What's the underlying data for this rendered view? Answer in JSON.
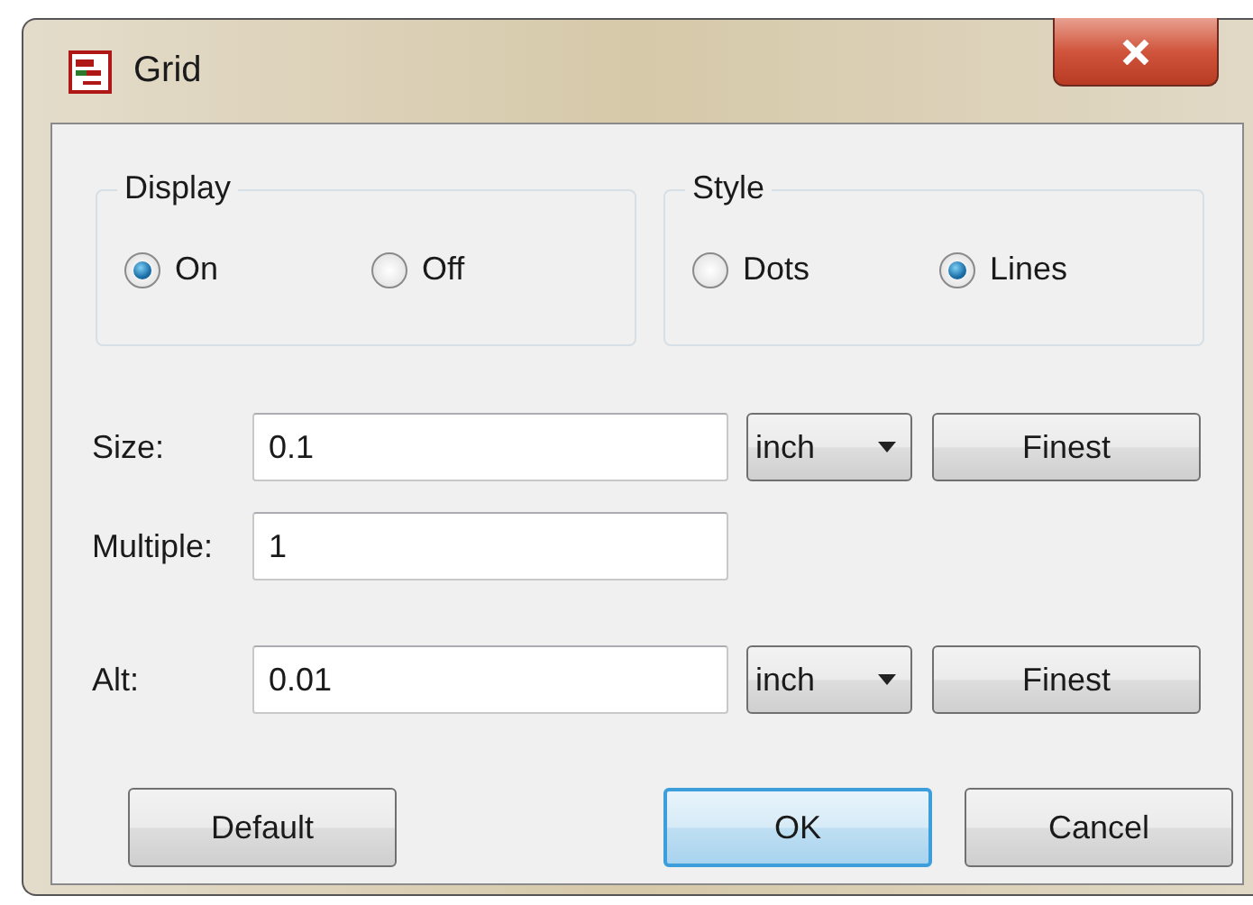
{
  "window": {
    "title": "Grid"
  },
  "groups": [
    {
      "title": "Display",
      "options": [
        {
          "label": "On",
          "selected": true
        },
        {
          "label": "Off",
          "selected": false
        }
      ]
    },
    {
      "title": "Style",
      "options": [
        {
          "label": "Dots",
          "selected": false
        },
        {
          "label": "Lines",
          "selected": true
        }
      ]
    }
  ],
  "fields": [
    {
      "label": "Size:",
      "value": "0.1",
      "unit": "inch",
      "button": "Finest"
    },
    {
      "label": "Multiple:",
      "value": "1"
    },
    {
      "label": "Alt:",
      "value": "0.01",
      "unit": "inch",
      "button": "Finest"
    }
  ],
  "buttons": [
    {
      "label": "Default",
      "default": false
    },
    {
      "label": "OK",
      "default": true
    },
    {
      "label": "Cancel",
      "default": false
    }
  ]
}
